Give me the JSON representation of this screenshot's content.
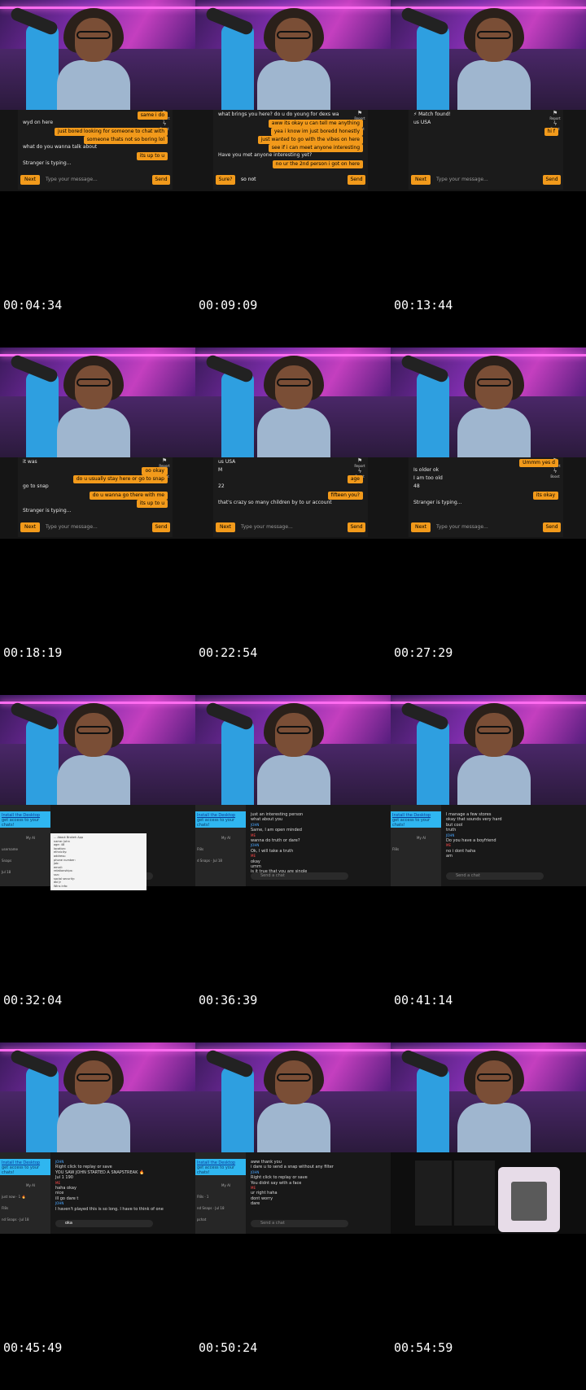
{
  "timestamps": [
    "00:04:34",
    "00:09:09",
    "00:13:44",
    "00:18:19",
    "00:22:54",
    "00:27:29",
    "00:32:04",
    "00:36:39",
    "00:41:14",
    "00:45:49",
    "00:50:24",
    "00:54:59"
  ],
  "omegle_ui": {
    "next_label": "Next",
    "send_label": "Send",
    "placeholder": "Type your message...",
    "report_label": "Report",
    "boost_label": "Boost",
    "accent": "#f29a1b"
  },
  "frames": [
    {
      "messages": [
        {
          "who": "me",
          "text": "same i do"
        },
        {
          "who": "them",
          "text": "wyd on here"
        },
        {
          "who": "me",
          "text": "just bored looking for someone to chat with"
        },
        {
          "who": "me",
          "text": "someone thats not so boring lol"
        },
        {
          "who": "them",
          "text": "what do you wanna talk about"
        },
        {
          "who": "me",
          "text": "its up to u"
        },
        {
          "who": "sys",
          "text": "Stranger is typing..."
        }
      ],
      "input_value": ""
    },
    {
      "messages": [
        {
          "who": "them",
          "text": "what brings you here? do u do young for dexs wa"
        },
        {
          "who": "me",
          "text": "aww its okay u can tell me anything"
        },
        {
          "who": "me",
          "text": "yea i know im just boredd honestly"
        },
        {
          "who": "me",
          "text": "just wanted to go with the vibes on here"
        },
        {
          "who": "me",
          "text": "see if i can meet anyone interesting"
        },
        {
          "who": "them",
          "text": "Have you met anyone interesting yet?"
        },
        {
          "who": "me",
          "text": "no ur the 2nd person i got on here"
        }
      ],
      "next_label_override": "Sure?",
      "input_value": "so not"
    },
    {
      "messages": [
        {
          "who": "sys",
          "text": "⚡ Match found!"
        },
        {
          "who": "sys",
          "text": "us USA"
        },
        {
          "who": "me",
          "text": "hi f"
        }
      ],
      "input_value": ""
    },
    {
      "messages": [
        {
          "who": "them",
          "text": "it was"
        },
        {
          "who": "me",
          "text": "oo okay"
        },
        {
          "who": "me",
          "text": "do u usually stay here or go to snap"
        },
        {
          "who": "them",
          "text": "go to snap"
        },
        {
          "who": "me",
          "text": "do u wanna go there with me"
        },
        {
          "who": "me",
          "text": "its up to u"
        },
        {
          "who": "sys",
          "text": "Stranger is typing..."
        }
      ],
      "input_value": ""
    },
    {
      "messages": [
        {
          "who": "them",
          "text": "us USA"
        },
        {
          "who": "them",
          "text": "M"
        },
        {
          "who": "me",
          "text": "age"
        },
        {
          "who": "them",
          "text": "22"
        },
        {
          "who": "me",
          "text": "fifteen you?"
        },
        {
          "who": "them",
          "text": "that's crazy so many children by to ur account"
        }
      ],
      "input_value": ""
    },
    {
      "messages": [
        {
          "who": "me",
          "text": "Ummm yes d"
        },
        {
          "who": "them",
          "text": "Is older ok"
        },
        {
          "who": "them",
          "text": "I am too old"
        },
        {
          "who": "them",
          "text": "48"
        },
        {
          "who": "me",
          "text": "its okay"
        },
        {
          "who": "sys",
          "text": "Stranger is typing..."
        }
      ],
      "input_value": ""
    }
  ],
  "snap_ui": {
    "banner_title": "Install the Desktop",
    "banner_sub": "get access to your chats!",
    "send_placeholder": "Send a chat",
    "my_ai": "My AI",
    "contact": "John",
    "accent_blue": "#2fb6f0",
    "name_color": "#4aa6ff",
    "me_color": "#ff4a4a"
  },
  "snap_frames": [
    {
      "lines": [],
      "doc_lines": [
        "... About Brokeh App",
        "name: John",
        "age: 48",
        "location:",
        "ethnicity:",
        "address:",
        "phone number:",
        "job:",
        "email:",
        "relationships:",
        "ssn:",
        "social security:",
        "dbl Jr",
        "Wins info:"
      ],
      "left_rows": [
        "username",
        "Snaps",
        "Jul 18"
      ]
    },
    {
      "lines": [
        {
          "who": "j",
          "text": "just an interesting person"
        },
        {
          "who": "j",
          "text": "what about you"
        },
        {
          "who": "label",
          "text": "JOHN"
        },
        {
          "who": "j",
          "text": "Same, I am open minded"
        },
        {
          "who": "label",
          "text": "ME"
        },
        {
          "who": "me",
          "text": "wanna do truth or dare?"
        },
        {
          "who": "label",
          "text": "JOHN"
        },
        {
          "who": "j",
          "text": "Ok, I will take a truth"
        },
        {
          "who": "label",
          "text": "ME"
        },
        {
          "who": "me",
          "text": "okay"
        },
        {
          "who": "me",
          "text": "umm"
        },
        {
          "who": "me",
          "text": "is it true that you are single"
        }
      ],
      "left_rows": [
        "Fl8s",
        "d Snaps · Jul 18"
      ]
    },
    {
      "lines": [
        {
          "who": "j",
          "text": "I manage a few stores"
        },
        {
          "who": "me",
          "text": "okay that sounds very hard"
        },
        {
          "who": "me",
          "text": "but cool"
        },
        {
          "who": "me",
          "text": "truth"
        },
        {
          "who": "label",
          "text": "JOHN"
        },
        {
          "who": "j",
          "text": "Do you have a boyfriend"
        },
        {
          "who": "label",
          "text": "ME"
        },
        {
          "who": "me",
          "text": "no i dont haha"
        },
        {
          "who": "me",
          "text": "am"
        }
      ],
      "left_rows": [
        "Fl8s"
      ]
    },
    {
      "lines": [
        {
          "who": "label",
          "text": "JOHN"
        },
        {
          "who": "j",
          "text": "Right click to replay or save"
        },
        {
          "who": "sys",
          "text": "YOU SAW JOHN STARTED A SNAPSTREAK 🔥"
        },
        {
          "who": "sys",
          "text": "Jul 1 190"
        },
        {
          "who": "label",
          "text": "ME"
        },
        {
          "who": "me",
          "text": "haha okay"
        },
        {
          "who": "me",
          "text": "nice"
        },
        {
          "who": "me",
          "text": "ill go dare t"
        },
        {
          "who": "label",
          "text": "JOHN"
        },
        {
          "who": "j",
          "text": "I haven't played this is so long.  I have to think of one"
        }
      ],
      "input_value": "oka",
      "left_rows": [
        "just now · 1 🔥",
        "Fl8s",
        "nd Snaps · Jul 18"
      ]
    },
    {
      "lines": [
        {
          "who": "j",
          "text": "aww thank you"
        },
        {
          "who": "j",
          "text": "i dare u to send a snap without any filter"
        },
        {
          "who": "label",
          "text": "JOHN"
        },
        {
          "who": "j",
          "text": "Right click to replay or save"
        },
        {
          "who": "j",
          "text": "You didnt say with a face"
        },
        {
          "who": "label",
          "text": "ME"
        },
        {
          "who": "me",
          "text": "ur right haha"
        },
        {
          "who": "me",
          "text": "dont worry"
        },
        {
          "who": "me",
          "text": "dare"
        }
      ],
      "left_rows": [
        "Fl8s · 1",
        "nd Snaps · Jul 18",
        "pchat"
      ]
    }
  ]
}
